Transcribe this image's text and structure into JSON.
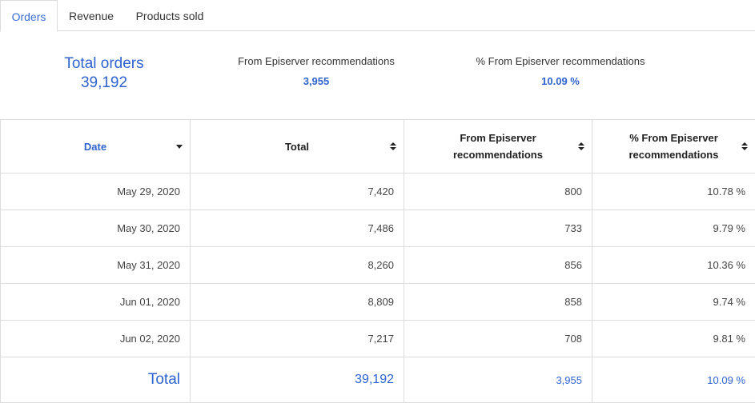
{
  "tabs": [
    {
      "label": "Orders",
      "active": true
    },
    {
      "label": "Revenue",
      "active": false
    },
    {
      "label": "Products sold",
      "active": false
    }
  ],
  "summary": {
    "total_orders_label": "Total orders",
    "total_orders_value": "39,192",
    "from_reco_label": "From Episerver recommendations",
    "from_reco_value": "3,955",
    "pct_reco_label": "% From Episerver recommendations",
    "pct_reco_value": "10.09 %"
  },
  "table": {
    "columns": [
      {
        "label": "Date",
        "sort": "desc"
      },
      {
        "label": "Total",
        "sort": "none"
      },
      {
        "label": "From Episerver recommendations",
        "sort": "none"
      },
      {
        "label": "% From Episerver recommendations",
        "sort": "none"
      }
    ],
    "rows": [
      {
        "date": "May 29, 2020",
        "total": "7,420",
        "reco": "800",
        "pct": "10.78 %"
      },
      {
        "date": "May 30, 2020",
        "total": "7,486",
        "reco": "733",
        "pct": "9.79 %"
      },
      {
        "date": "May 31, 2020",
        "total": "8,260",
        "reco": "856",
        "pct": "10.36 %"
      },
      {
        "date": "Jun 01, 2020",
        "total": "8,809",
        "reco": "858",
        "pct": "9.74 %"
      },
      {
        "date": "Jun 02, 2020",
        "total": "7,217",
        "reco": "708",
        "pct": "9.81 %"
      }
    ],
    "totals": {
      "label": "Total",
      "total": "39,192",
      "reco": "3,955",
      "pct": "10.09 %"
    }
  },
  "colors": {
    "accent": "#2f63cf",
    "border": "#dddddd",
    "text": "#333333"
  }
}
